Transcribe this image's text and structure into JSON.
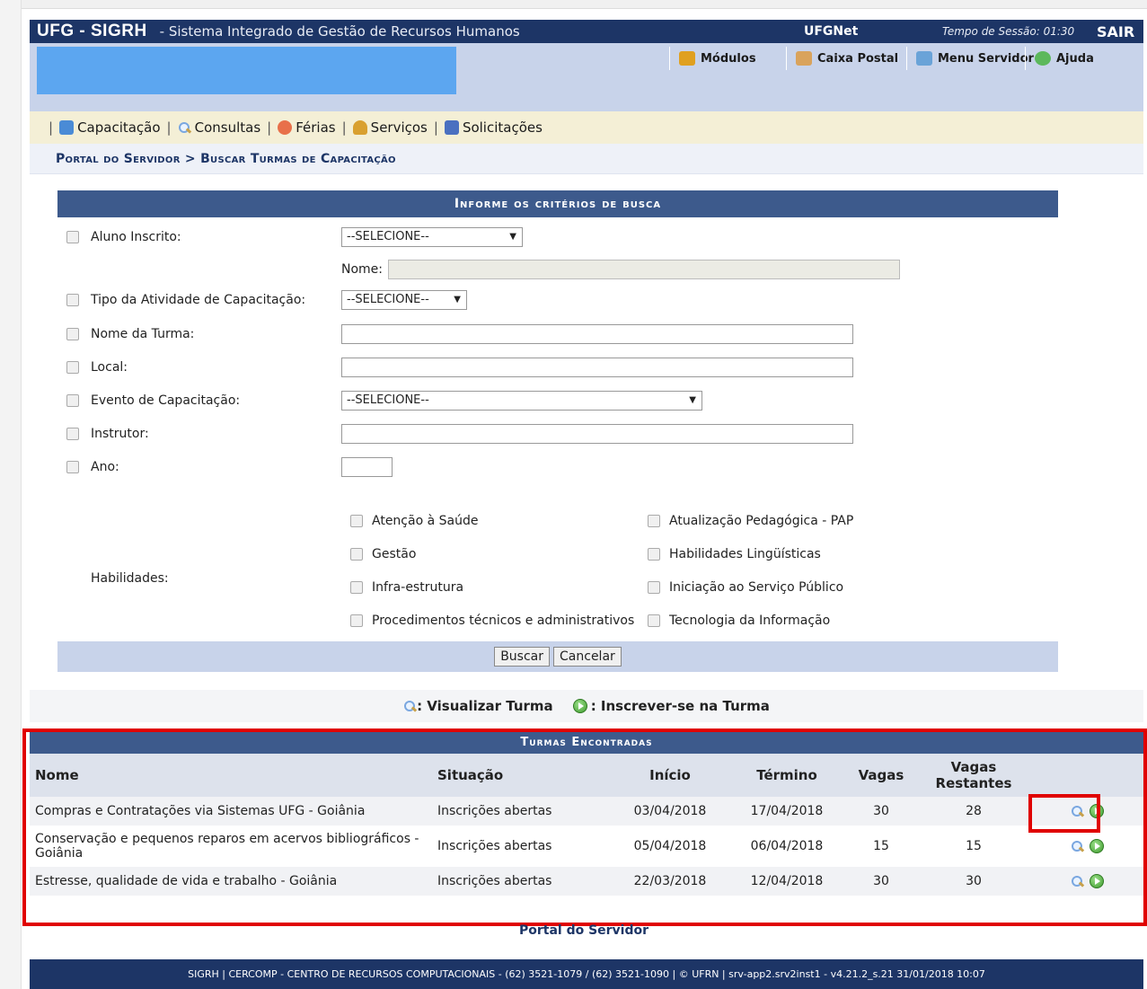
{
  "header": {
    "app_name": "UFG - SIGRH",
    "subtitle": "- Sistema Integrado de Gestão de Recursos Humanos",
    "network": "UFGNet",
    "session": "Tempo de Sessão: 01:30",
    "logout": "SAIR"
  },
  "toolbar": {
    "modulos": "Módulos",
    "caixa_postal": "Caixa Postal",
    "menu_servidor": "Menu Servidor",
    "ajuda": "Ajuda"
  },
  "menu": {
    "items": [
      "Capacitação",
      "Consultas",
      "Férias",
      "Serviços",
      "Solicitações"
    ]
  },
  "breadcrumb": "Portal do Servidor > Buscar Turmas de Capacitação",
  "form": {
    "title": "Informe os critérios de busca",
    "aluno_inscrito": "Aluno Inscrito:",
    "aluno_select": "--SELECIONE--",
    "nome_label": "Nome:",
    "tipo_atividade": "Tipo da Atividade de Capacitação:",
    "tipo_select": "--SELECIONE--",
    "nome_turma": "Nome da Turma:",
    "local": "Local:",
    "evento": "Evento de Capacitação:",
    "evento_select": "--SELECIONE--",
    "instrutor": "Instrutor:",
    "ano": "Ano:",
    "habilidades_label": "Habilidades:",
    "habilidades": [
      "Atenção à Saúde",
      "Atualização Pedagógica - PAP",
      "Gestão",
      "Habilidades Lingüísticas",
      "Infra-estrutura",
      "Iniciação ao Serviço Público",
      "Procedimentos técnicos e administrativos",
      "Tecnologia da Informação"
    ],
    "buscar": "Buscar",
    "cancelar": "Cancelar"
  },
  "legend": {
    "visualizar": ": Visualizar Turma",
    "inscrever": ": Inscrever-se na Turma"
  },
  "results": {
    "title": "Turmas Encontradas",
    "columns": [
      "Nome",
      "Situação",
      "Início",
      "Término",
      "Vagas",
      "Vagas Restantes"
    ],
    "rows": [
      {
        "nome": "Compras e Contratações via Sistemas UFG - Goiânia",
        "situacao": "Inscrições abertas",
        "inicio": "03/04/2018",
        "termino": "17/04/2018",
        "vagas": "30",
        "restantes": "28"
      },
      {
        "nome": "Conservação e pequenos reparos em acervos bibliográficos - Goiânia",
        "situacao": "Inscrições abertas",
        "inicio": "05/04/2018",
        "termino": "06/04/2018",
        "vagas": "15",
        "restantes": "15"
      },
      {
        "nome": "Estresse, qualidade de vida e trabalho - Goiânia",
        "situacao": "Inscrições abertas",
        "inicio": "22/03/2018",
        "termino": "12/04/2018",
        "vagas": "30",
        "restantes": "30"
      }
    ]
  },
  "portal_link": "Portal do Servidor",
  "footer": "SIGRH | CERCOMP - CENTRO DE RECURSOS COMPUTACIONAIS - (62) 3521-1079 / (62) 3521-1090 | © UFRN | srv-app2.srv2inst1 - v4.21.2_s.21 31/01/2018 10:07",
  "colors": {
    "header_navy": "#1d3566",
    "form_header": "#3d5a8c",
    "user_bar": "#c8d3ea",
    "menu_bar": "#f4efd6",
    "highlight_red": "#e00000"
  }
}
